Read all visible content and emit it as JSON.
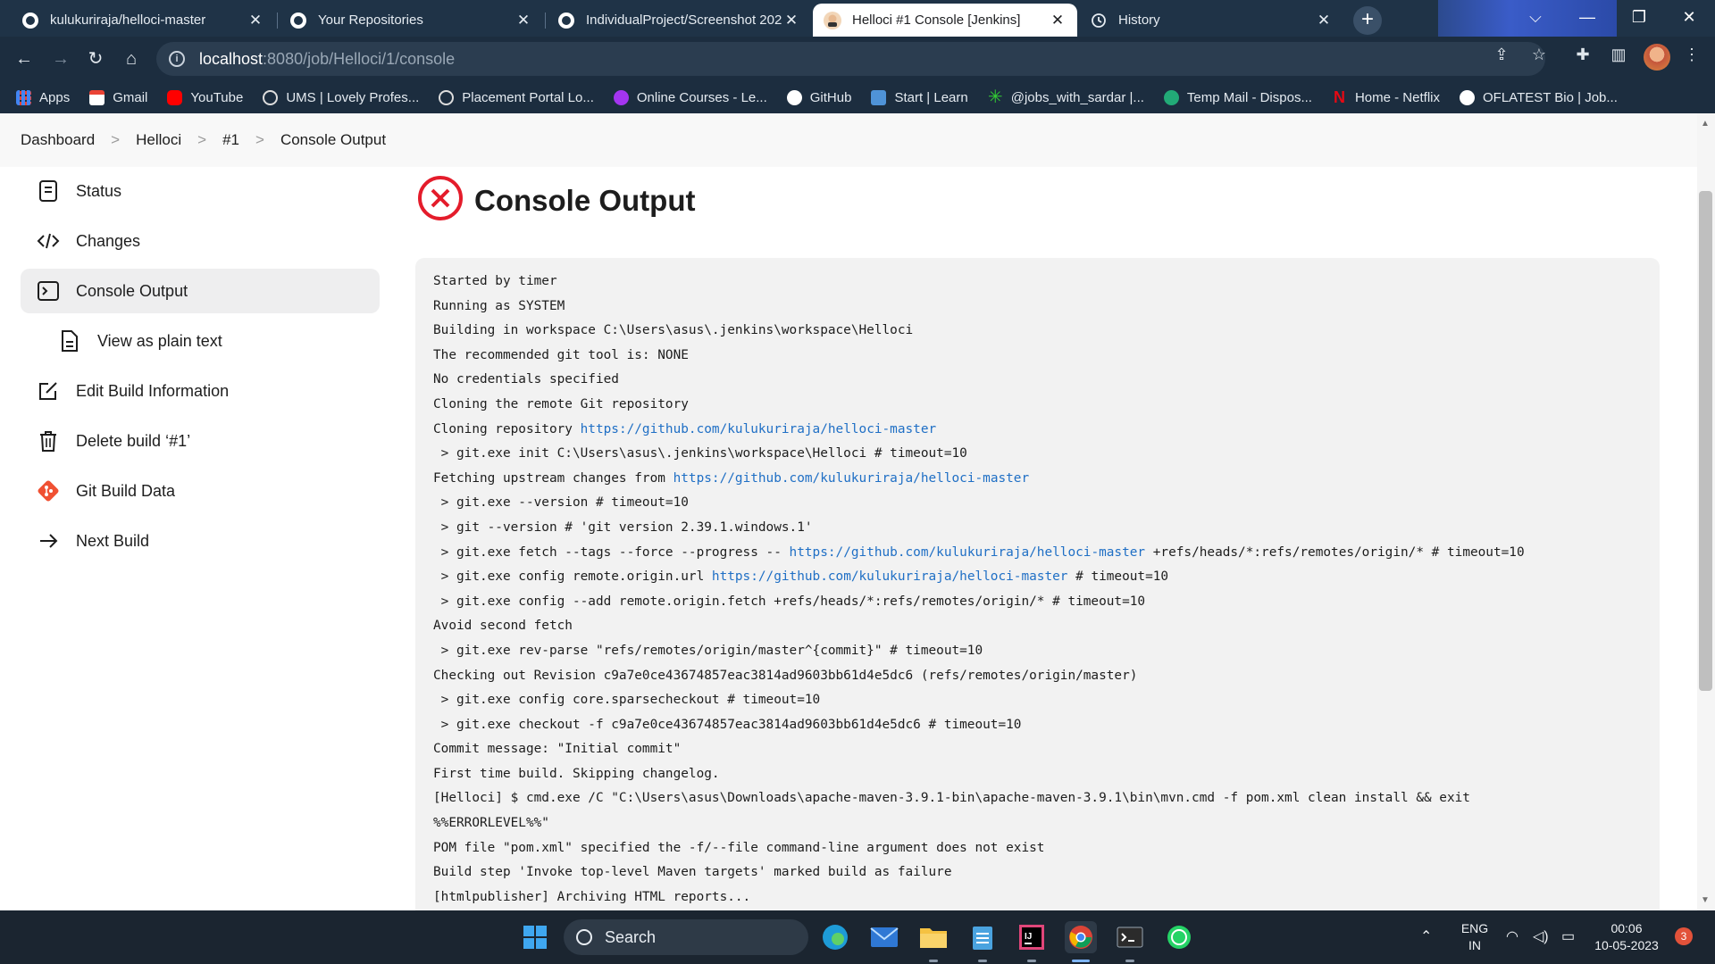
{
  "browser": {
    "tabs": [
      {
        "title": "kulukuriraja/helloci-master",
        "icon": "github-icon"
      },
      {
        "title": "Your Repositories",
        "icon": "github-icon"
      },
      {
        "title": "IndividualProject/Screenshot 202",
        "icon": "github-icon"
      },
      {
        "title": "Helloci #1 Console [Jenkins]",
        "icon": "jenkins-icon"
      },
      {
        "title": "History",
        "icon": "history-icon"
      }
    ],
    "active_tab_index": 3,
    "url_host": "localhost",
    "url_path": ":8080/job/Helloci/1/console",
    "bookmarks": [
      {
        "label": "Apps",
        "color": "#4285f4"
      },
      {
        "label": "Gmail",
        "color": "#ea4335"
      },
      {
        "label": "YouTube",
        "color": "#ff0000"
      },
      {
        "label": "UMS | Lovely Profes...",
        "color": "#dddddd"
      },
      {
        "label": "Placement Portal Lo...",
        "color": "#dddddd"
      },
      {
        "label": "Online Courses - Le...",
        "color": "#a435f0"
      },
      {
        "label": "GitHub",
        "color": "#ffffff"
      },
      {
        "label": "Start | Learn",
        "color": "#4f93d8"
      },
      {
        "label": "@jobs_with_sardar |...",
        "color": "#33cc33"
      },
      {
        "label": "Temp Mail - Dispos...",
        "color": "#22aa77"
      },
      {
        "label": "Home - Netflix",
        "color": "#e50914"
      },
      {
        "label": "OFLATEST Bio | Job...",
        "color": "#ffffff"
      }
    ]
  },
  "breadcrumb": [
    "Dashboard",
    "Helloci",
    "#1",
    "Console Output"
  ],
  "sidebar": [
    {
      "label": "Status",
      "icon": "document-icon"
    },
    {
      "label": "Changes",
      "icon": "code-icon"
    },
    {
      "label": "Console Output",
      "icon": "terminal-icon",
      "active": true
    },
    {
      "label": "View as plain text",
      "icon": "file-icon",
      "sub": true
    },
    {
      "label": "Edit Build Information",
      "icon": "edit-icon"
    },
    {
      "label": "Delete build ‘#1’",
      "icon": "trash-icon"
    },
    {
      "label": "Git Build Data",
      "icon": "git-icon"
    },
    {
      "label": "Next Build",
      "icon": "arrow-right-icon"
    }
  ],
  "page_title": "Console Output",
  "status_color": "#e41c2b",
  "console_lines": [
    {
      "text": "Started by timer"
    },
    {
      "text": "Running as SYSTEM"
    },
    {
      "text": "Building in workspace C:\\Users\\asus\\.jenkins\\workspace\\Helloci"
    },
    {
      "text": "The recommended git tool is: NONE"
    },
    {
      "text": "No credentials specified"
    },
    {
      "text": "Cloning the remote Git repository"
    },
    {
      "text": "Cloning repository ",
      "link": "https://github.com/kulukuriraja/helloci-master",
      "after": ""
    },
    {
      "text": " > git.exe init C:\\Users\\asus\\.jenkins\\workspace\\Helloci # timeout=10"
    },
    {
      "text": "Fetching upstream changes from ",
      "link": "https://github.com/kulukuriraja/helloci-master",
      "after": ""
    },
    {
      "text": " > git.exe --version # timeout=10"
    },
    {
      "text": " > git --version # 'git version 2.39.1.windows.1'"
    },
    {
      "text": " > git.exe fetch --tags --force --progress -- ",
      "link": "https://github.com/kulukuriraja/helloci-master",
      "after": " +refs/heads/*:refs/remotes/origin/* # timeout=10"
    },
    {
      "text": " > git.exe config remote.origin.url ",
      "link": "https://github.com/kulukuriraja/helloci-master",
      "after": " # timeout=10"
    },
    {
      "text": " > git.exe config --add remote.origin.fetch +refs/heads/*:refs/remotes/origin/* # timeout=10"
    },
    {
      "text": "Avoid second fetch"
    },
    {
      "text": " > git.exe rev-parse \"refs/remotes/origin/master^{commit}\" # timeout=10"
    },
    {
      "text": "Checking out Revision c9a7e0ce43674857eac3814ad9603bb61d4e5dc6 (refs/remotes/origin/master)"
    },
    {
      "text": " > git.exe config core.sparsecheckout # timeout=10"
    },
    {
      "text": " > git.exe checkout -f c9a7e0ce43674857eac3814ad9603bb61d4e5dc6 # timeout=10"
    },
    {
      "text": "Commit message: \"Initial commit\""
    },
    {
      "text": "First time build. Skipping changelog."
    },
    {
      "text": "[Helloci] $ cmd.exe /C \"C:\\Users\\asus\\Downloads\\apache-maven-3.9.1-bin\\apache-maven-3.9.1\\bin\\mvn.cmd -f pom.xml clean install && exit"
    },
    {
      "text": "%%ERRORLEVEL%%\""
    },
    {
      "text": "POM file \"pom.xml\" specified the -f/--file command-line argument does not exist"
    },
    {
      "text": "Build step 'Invoke top-level Maven targets' marked build as failure"
    },
    {
      "text": "[htmlpublisher] Archiving HTML reports..."
    }
  ],
  "taskbar": {
    "search_label": "Search",
    "lang_line1": "ENG",
    "lang_line2": "IN",
    "time": "00:06",
    "date": "10-05-2023",
    "notification_count": "3"
  }
}
